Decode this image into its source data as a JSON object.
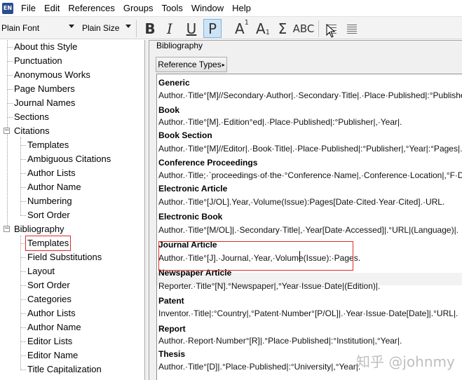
{
  "app_icon_text": "EN",
  "menu": [
    "File",
    "Edit",
    "References",
    "Groups",
    "Tools",
    "Window",
    "Help"
  ],
  "toolbar": {
    "font_select": "Plain Font",
    "size_select": "Plain Size",
    "bold_label": "B",
    "italic_label": "I",
    "underline_label": "U",
    "plain_label": "P",
    "superscript_label": "A",
    "superscript_mark": "1",
    "subscript_label": "A",
    "subscript_mark": "1",
    "symbol_label": "Σ",
    "smallcaps_label": "ABC"
  },
  "tree": {
    "items": [
      {
        "label": "About this Style"
      },
      {
        "label": "Punctuation"
      },
      {
        "label": "Anonymous Works"
      },
      {
        "label": "Page Numbers"
      },
      {
        "label": "Journal Names"
      },
      {
        "label": "Sections"
      },
      {
        "label": "Citations",
        "expander": "−"
      },
      {
        "label": "Templates"
      },
      {
        "label": "Ambiguous Citations"
      },
      {
        "label": "Author Lists"
      },
      {
        "label": "Author Name"
      },
      {
        "label": "Numbering"
      },
      {
        "label": "Sort Order"
      },
      {
        "label": "Bibliography",
        "expander": "−"
      },
      {
        "label": "Templates",
        "selected": true
      },
      {
        "label": "Field Substitutions"
      },
      {
        "label": "Layout"
      },
      {
        "label": "Sort Order"
      },
      {
        "label": "Categories"
      },
      {
        "label": "Author Lists"
      },
      {
        "label": "Author Name"
      },
      {
        "label": "Editor Lists"
      },
      {
        "label": "Editor Name"
      },
      {
        "label": "Title Capitalization"
      }
    ]
  },
  "panel": {
    "title": "Bibliography",
    "ref_types_button": "Reference Types",
    "ref_types_arrow": "▸"
  },
  "templates": [
    {
      "name": "Generic",
      "body": "Author.·Title°[M]//Secondary·Author|.·Secondary·Title|.·Place·Published|:°Publisher"
    },
    {
      "name": "Book",
      "body": "Author.·Title°[M].·Edition°ed|.·Place·Published|:°Publisher|,·Year|."
    },
    {
      "name": "Book Section",
      "body": "Author.·Title°[M]//Editor|.·Book·Title|.·Place·Published|:°Publisher|,°Year|:°Pages|."
    },
    {
      "name": "Conference Proceedings",
      "body": "Author.·Title;·`proceedings·of·the·°Conference·Name|,·Conference·Location|,°F·Date"
    },
    {
      "name": "Electronic Article",
      "body": "Author.·Title°[J/OL].Year,·Volume(Issue):Pages[Date·Cited·Year·Cited].·URL."
    },
    {
      "name": "Electronic Book",
      "body": "Author.·Title°[M/OL]|.·Secondary·Title|,·Year[Date·Accessed]|.°URL|(Language)|."
    },
    {
      "name": "Journal Article",
      "body": "Author.·Title°[J].·Journal,·Year,·Volume(Issue):·Pages."
    },
    {
      "name": "Newspaper Article",
      "body": "Reporter.·Title°[N].°Newspaper|,°Year·Issue·Date|(Edition)|."
    },
    {
      "name": "Patent",
      "body": "Inventor.·Title|:°Country|,°Patent·Number°[P/OL]|.·Year·Issue·Date[Date]|.°URL|."
    },
    {
      "name": "Report",
      "body": "Author.·Report·Number°[R]|.°Place·Published|:°Institution|,°Year|."
    },
    {
      "name": "Thesis",
      "body": "Author.·Title°[D]|.°Place·Published|:°University|,°Year|."
    }
  ],
  "watermark": "知乎 @johnmy"
}
